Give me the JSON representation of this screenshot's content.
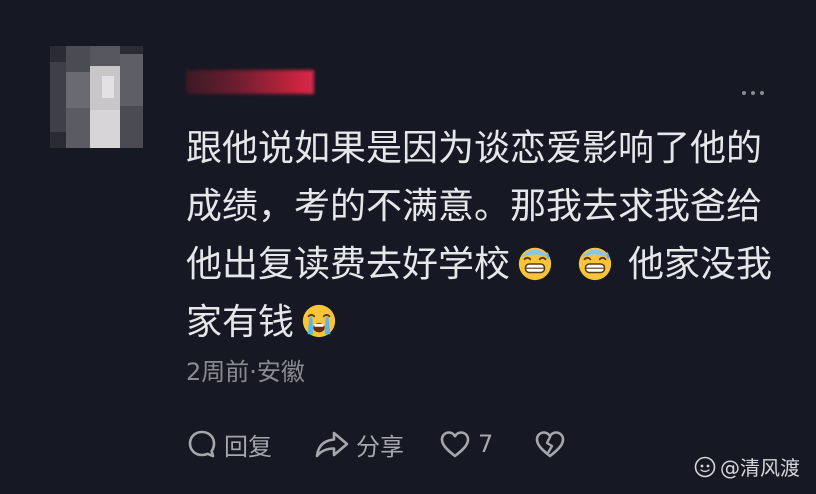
{
  "comment": {
    "lines": [
      "跟他说如果是因为谈恋爱影响了他的",
      "成绩，考的不满意。那我去求我爸给",
      "他出复读费去好学校",
      "他家没我",
      "家有钱"
    ],
    "emoji": [
      "sweat-grin-emoji",
      "sweat-grin-emoji",
      "crying-emoji"
    ]
  },
  "meta": {
    "time_location": "2周前·安徽"
  },
  "actions": {
    "reply_label": "回复",
    "share_label": "分享",
    "like_count": "7"
  },
  "watermark": {
    "text": "@清风渡"
  },
  "colors": {
    "background": "#161823",
    "text": "#e6e7ea",
    "meta": "#8b8c91",
    "username_blur": "#c4243d"
  }
}
